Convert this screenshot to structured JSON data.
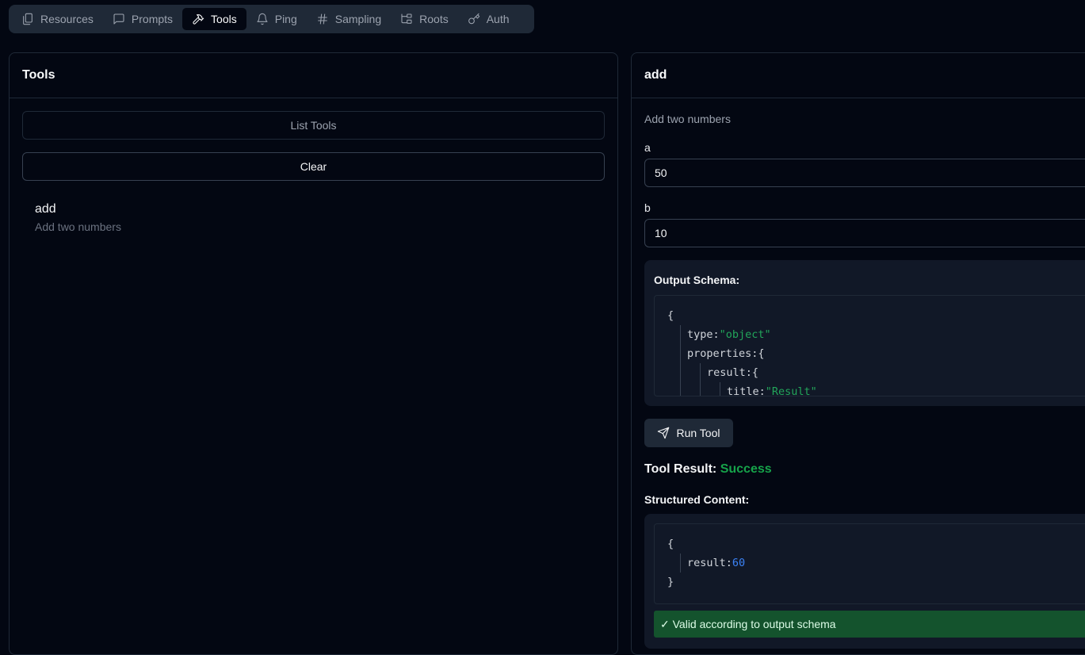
{
  "tabs": [
    {
      "label": "Resources",
      "icon": "files-icon",
      "active": false
    },
    {
      "label": "Prompts",
      "icon": "message-square-icon",
      "active": false
    },
    {
      "label": "Tools",
      "icon": "hammer-icon",
      "active": true
    },
    {
      "label": "Ping",
      "icon": "bell-icon",
      "active": false
    },
    {
      "label": "Sampling",
      "icon": "hash-icon",
      "active": false
    },
    {
      "label": "Roots",
      "icon": "folder-tree-icon",
      "active": false
    },
    {
      "label": "Auth",
      "icon": "key-icon",
      "active": false
    }
  ],
  "left": {
    "title": "Tools",
    "list_label": "List Tools",
    "clear_label": "Clear",
    "tools": [
      {
        "name": "add",
        "description": "Add two numbers"
      }
    ]
  },
  "right": {
    "title": "add",
    "description": "Add two numbers",
    "fields": [
      {
        "label": "a",
        "value": "50"
      },
      {
        "label": "b",
        "value": "10"
      }
    ],
    "output_schema_title": "Output Schema:",
    "schema_lines": {
      "l1": "{",
      "l2_key": "type:",
      "l2_val": "\"object\"",
      "l3_key": "properties:",
      "l3_val": "{",
      "l4_key": "result:",
      "l4_val": "{",
      "l5_key": "title:",
      "l5_val": "\"Result\""
    },
    "run_label": "Run Tool",
    "result_label": "Tool Result:",
    "result_status": "Success",
    "structured_title": "Structured Content:",
    "structured_lines": {
      "open": "{",
      "key": "result:",
      "val": "60",
      "close": "}"
    },
    "valid_message": "✓ Valid according to output schema"
  },
  "colors": {
    "background": "#030712",
    "success": "#16a34a",
    "string": "#22a55a",
    "number": "#3b82f6",
    "valid_bg": "#14532d"
  }
}
